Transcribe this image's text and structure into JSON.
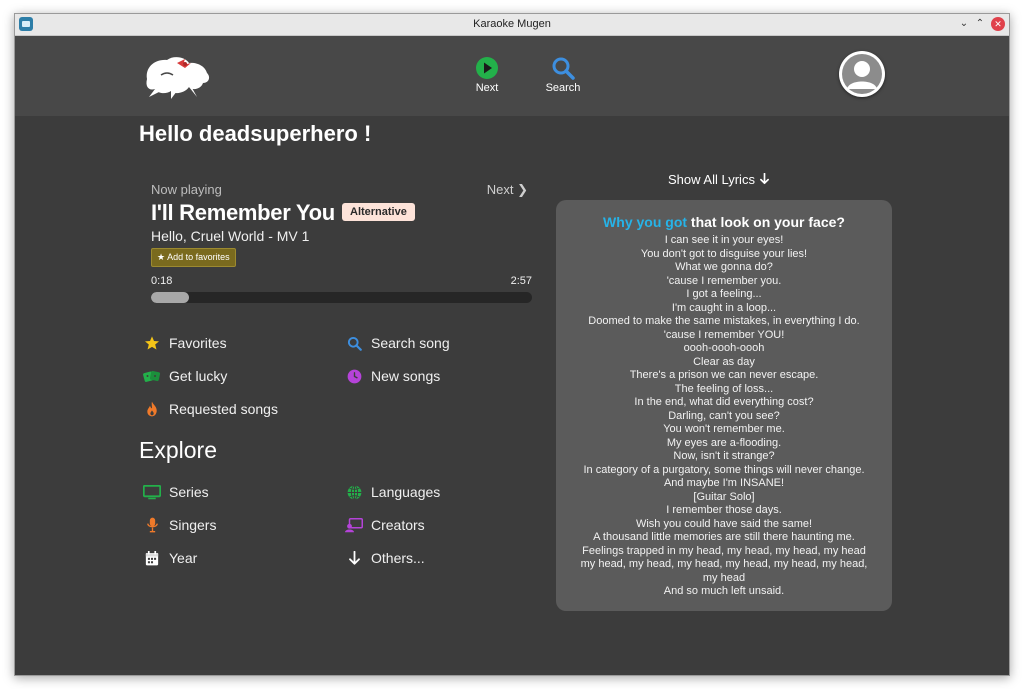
{
  "window": {
    "title": "Karaoke Mugen"
  },
  "topbar": {
    "next_label": "Next",
    "search_label": "Search"
  },
  "greeting": "Hello deadsuperhero !",
  "player": {
    "now_playing_label": "Now playing",
    "next_label": "Next",
    "title": "I'll Remember You",
    "tag": "Alternative",
    "series": "Hello, Cruel World - MV 1",
    "favorite_label": "Add to favorites",
    "current_time": "0:18",
    "total_time": "2:57",
    "progress": 0.1
  },
  "menu": {
    "favorites": "Favorites",
    "search_song": "Search song",
    "get_lucky": "Get lucky",
    "new_songs": "New songs",
    "requested_songs": "Requested songs"
  },
  "explore": {
    "title": "Explore",
    "series": "Series",
    "languages": "Languages",
    "singers": "Singers",
    "creators": "Creators",
    "year": "Year",
    "others": "Others..."
  },
  "lyrics": {
    "toggle_label": "Show All Lyrics",
    "head_highlight": "Why you got",
    "head_rest": " that look on your face?",
    "lines": [
      "I can see it in your eyes!",
      "You don't got to disguise your lies!",
      "What we gonna do?",
      "'cause I remember you.",
      "I got a feeling...",
      "I'm caught in a loop...",
      "Doomed to make the same mistakes, in everything I do.",
      "'cause I remember YOU!",
      "oooh-oooh-oooh",
      "Clear as day",
      "There's a prison we can never escape.",
      "The feeling of loss...",
      "In the end, what did everything cost?",
      "Darling, can't you see?",
      "You won't remember me.",
      "My eyes are a-flooding.",
      "Now, isn't it strange?",
      "In category of a purgatory, some things will never change.",
      "And maybe I'm INSANE!",
      "[Guitar Solo]",
      "I remember those days.",
      "Wish you could have said the same!",
      "A thousand little memories are still there haunting me.",
      "Feelings trapped in my head, my head, my head, my head",
      "my head, my head, my head, my head, my head, my head, my head",
      "And so much left unsaid."
    ]
  },
  "colors": {
    "background": "#3c3c3c",
    "topbar": "#484848",
    "accent_blue": "#26b3e8",
    "next_green": "#23b04a",
    "favorite_gold": "#f5c518",
    "tag_bg": "#fde3d9"
  },
  "icons": {
    "next": "play-circle-icon",
    "search": "magnifier-icon",
    "favorites": "star-icon",
    "get_lucky": "dice-icon",
    "requested": "fire-icon",
    "search_song": "magnifier-icon",
    "new_songs": "clock-icon",
    "series": "tv-icon",
    "languages": "globe-icon",
    "singers": "microphone-icon",
    "creators": "creator-icon",
    "year": "calendar-icon",
    "others": "arrow-down-icon"
  }
}
